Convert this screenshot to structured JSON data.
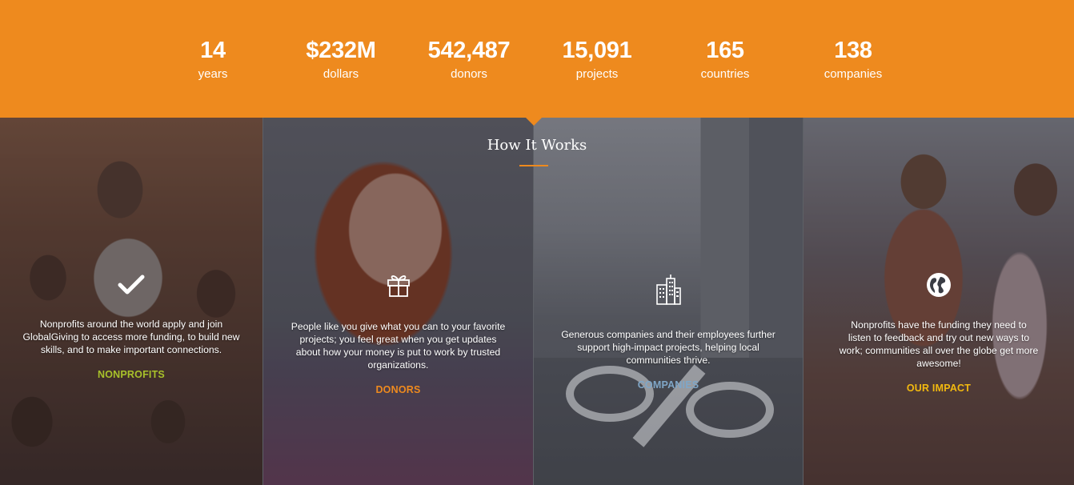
{
  "stats": [
    {
      "value": "14",
      "label": "years"
    },
    {
      "value": "$232M",
      "label": "dollars"
    },
    {
      "value": "542,487",
      "label": "donors"
    },
    {
      "value": "15,091",
      "label": "projects"
    },
    {
      "value": "165",
      "label": "countries"
    },
    {
      "value": "138",
      "label": "companies"
    }
  ],
  "how_it_works": {
    "title": "How It Works",
    "panels": [
      {
        "icon": "checkmark-icon",
        "text": "Nonprofits around the world apply and join GlobalGiving to access more funding, to build new skills, and to make important connections.",
        "cta": "NONPROFITS",
        "cta_color": "#a8c12a"
      },
      {
        "icon": "gift-icon",
        "text": "People like you give what you can to your favorite projects; you feel great when you get updates about how your money is put to work by trusted organizations.",
        "cta": "DONORS",
        "cta_color": "#ee8a1e"
      },
      {
        "icon": "buildings-icon",
        "text": "Generous companies and their employees further support high-impact projects, helping local communities thrive.",
        "cta": "COMPANIES",
        "cta_color": "#7fa6c7"
      },
      {
        "icon": "globe-icon",
        "text": "Nonprofits have the funding they need to listen to feedback and try out new ways to work; communities all over the globe get more awesome!",
        "cta": "OUR IMPACT",
        "cta_color": "#f2b90f"
      }
    ]
  },
  "colors": {
    "accent_orange": "#ee8a1e",
    "white": "#ffffff"
  }
}
